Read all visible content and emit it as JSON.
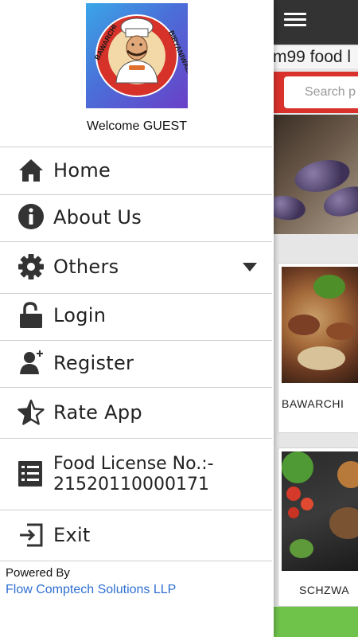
{
  "background": {
    "marquee_text": "m99 food l",
    "search_placeholder": "Search p",
    "cards": [
      {
        "label": "BAWARCHI"
      },
      {
        "label": "SCHZWA"
      }
    ],
    "colors": {
      "toolbar": "#333333",
      "search_band": "#d9312b",
      "bottom_bar": "#6fc24a"
    }
  },
  "drawer": {
    "logo": {
      "text_left": "BAWARCHI",
      "text_right": "BIRYANIWALA"
    },
    "welcome": "Welcome GUEST",
    "menu": [
      {
        "icon": "home-icon",
        "label": "Home"
      },
      {
        "icon": "info-icon",
        "label": "About Us"
      },
      {
        "icon": "gear-icon",
        "label": "Others"
      },
      {
        "icon": "unlock-icon",
        "label": "Login"
      },
      {
        "icon": "add-user-icon",
        "label": "Register"
      },
      {
        "icon": "star-icon",
        "label": "Rate App"
      }
    ],
    "license": {
      "icon": "list-icon",
      "title": "Food License No.:-",
      "number": "21520110000171"
    },
    "exit": {
      "icon": "exit-icon",
      "label": "Exit"
    },
    "footer": {
      "powered_by": "Powered By",
      "company": "Flow Comptech Solutions LLP"
    }
  }
}
